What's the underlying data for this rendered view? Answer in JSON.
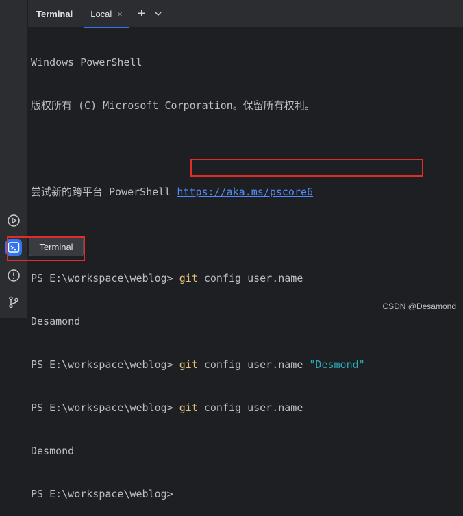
{
  "header": {
    "panel_title": "Terminal",
    "tab_label": "Local",
    "close_glyph": "×",
    "add_glyph": "+"
  },
  "sidebar": {
    "icons": [
      "run-icon",
      "terminal-icon",
      "problems-icon",
      "git-icon"
    ],
    "tooltip": "Terminal",
    "active_color": "#3574f0"
  },
  "terminal": {
    "lines": [
      {
        "text": "Windows PowerShell"
      },
      {
        "text": "版权所有 (C) Microsoft Corporation。保留所有权利。"
      },
      {
        "text": ""
      },
      {
        "prefix": "尝试新的跨平台 PowerShell ",
        "link": "https://aka.ms/pscore6"
      },
      {
        "text": ""
      },
      {
        "prompt": "PS E:\\workspace\\weblog> ",
        "cmd": "git",
        "args": " config user.name"
      },
      {
        "text": "Desamond"
      },
      {
        "prompt": "PS E:\\workspace\\weblog> ",
        "cmd": "git",
        "args": " config user.name ",
        "str": "\"Desmond\""
      },
      {
        "prompt": "PS E:\\workspace\\weblog> ",
        "cmd": "git",
        "args": " config user.name"
      },
      {
        "text": "Desmond"
      },
      {
        "prompt": "PS E:\\workspace\\weblog>"
      }
    ]
  },
  "watermark": "CSDN @Desamond",
  "colors": {
    "background": "#1e1f22",
    "panel": "#2b2d30",
    "command": "#e5c07b",
    "string": "#2aacb8",
    "link": "#548af7",
    "highlight_border": "#e22b2b"
  }
}
